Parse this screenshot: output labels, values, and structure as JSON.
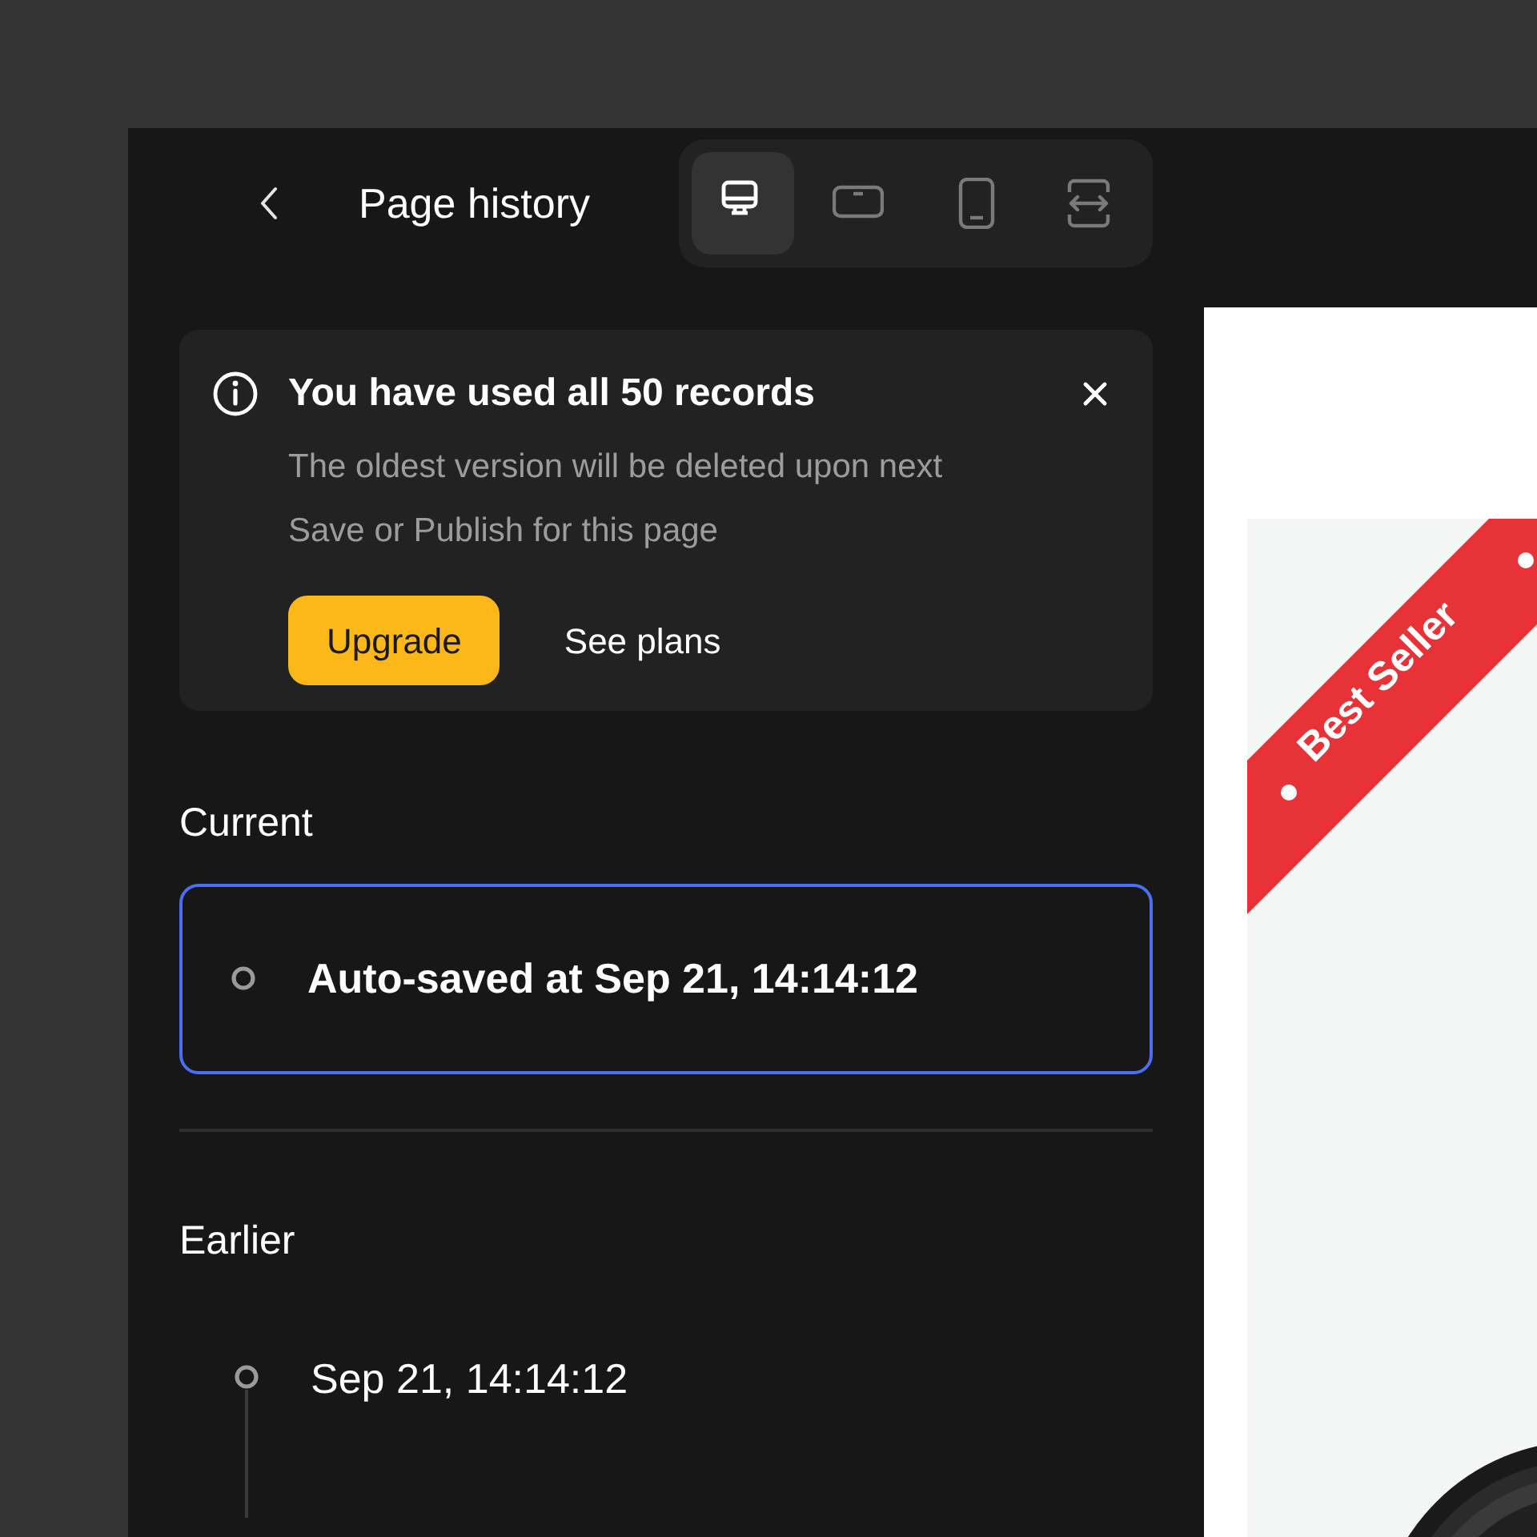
{
  "header": {
    "title": "Page history"
  },
  "devices": [
    {
      "kind": "desktop",
      "selected": true
    },
    {
      "kind": "tablet",
      "selected": false
    },
    {
      "kind": "mobile",
      "selected": false
    },
    {
      "kind": "fit",
      "selected": false
    }
  ],
  "notice": {
    "title": "You have used all 50 records",
    "message": "The oldest version will be deleted upon next Save or Publish for this page",
    "buttons": [
      {
        "label": "Upgrade",
        "kind": "primary"
      },
      {
        "label": "See plans",
        "kind": "link"
      }
    ]
  },
  "current": {
    "heading": "Current",
    "entry": {
      "label": "Auto-saved at Sep 21, 14:14:12",
      "selected": true
    }
  },
  "earlier": {
    "heading": "Earlier",
    "entries": [
      {
        "label": "Sep 21, 14:14:12",
        "selected": false
      }
    ]
  },
  "preview": {
    "badge": "Best Seller"
  }
}
